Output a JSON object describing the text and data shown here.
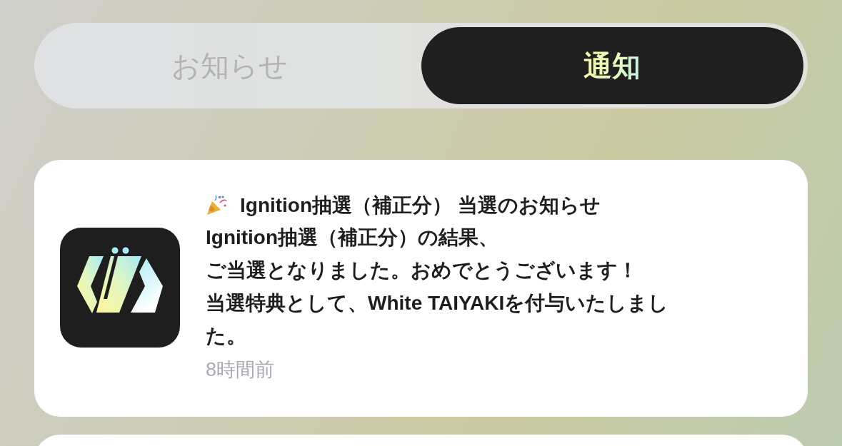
{
  "tabs": [
    {
      "label": "お知らせ",
      "selected": false
    },
    {
      "label": "通知",
      "selected": true
    }
  ],
  "notifications": [
    {
      "title": "Ignition抽選（補正分） 当選のお知らせ",
      "body_lines": [
        "Ignition抽選（補正分）の結果、",
        "ご当選となりました。おめでとうございます！",
        "当選特典として、White TAIYAKIを付与いたしました。"
      ],
      "time": "8時間前"
    }
  ]
}
